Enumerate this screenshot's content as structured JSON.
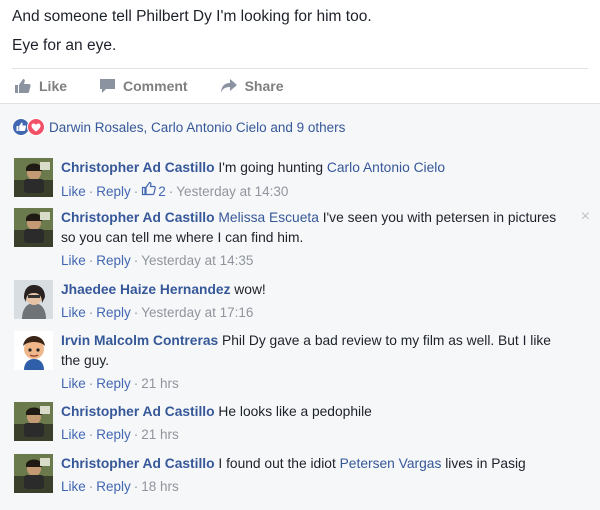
{
  "post": {
    "line1": "And someone tell Philbert Dy I'm looking for him too.",
    "line2": "Eye for an eye."
  },
  "actions": {
    "like": "Like",
    "comment": "Comment",
    "share": "Share"
  },
  "reactions": {
    "names": "Darwin Rosales, Carlo Antonio Cielo and 9 others"
  },
  "comments": [
    {
      "author": "Christopher Ad Castillo",
      "text": " I'm going hunting ",
      "mention": "Carlo Antonio Cielo",
      "like": "Like",
      "reply": "Reply",
      "likes": "2",
      "time": "Yesterday at 14:30"
    },
    {
      "author": "Christopher Ad Castillo",
      "mention": "Melissa Escueta",
      "text": " I've seen you with petersen in pictures",
      "text2": "so you can tell me where I can find him.",
      "like": "Like",
      "reply": "Reply",
      "time": "Yesterday at 14:35",
      "close": "×"
    },
    {
      "author": "Jhaedee Haize Hernandez",
      "text": " wow!",
      "like": "Like",
      "reply": "Reply",
      "time": "Yesterday at 17:16"
    },
    {
      "author": "Irvin Malcolm Contreras",
      "text": " Phil Dy gave a bad review to my film as well. But I like",
      "text2": "the guy.",
      "like": "Like",
      "reply": "Reply",
      "time": "21 hrs"
    },
    {
      "author": "Christopher Ad Castillo",
      "text": " He looks like a pedophile",
      "like": "Like",
      "reply": "Reply",
      "time": "21 hrs"
    },
    {
      "author": "Christopher Ad Castillo",
      "text": " I found out the idiot ",
      "mention": "Petersen Vargas",
      "text3": " lives in Pasig",
      "like": "Like",
      "reply": "Reply",
      "time": "18 hrs"
    }
  ],
  "icons": {
    "like": "thumbs-up-icon",
    "comment": "speech-bubble-icon",
    "share": "share-arrow-icon",
    "reaction_like": "like-reaction-icon",
    "reaction_love": "love-reaction-icon"
  },
  "colors": {
    "link": "#365899",
    "meta": "#90949c",
    "like_blue": "#4267b2",
    "love_red": "#f25268"
  }
}
